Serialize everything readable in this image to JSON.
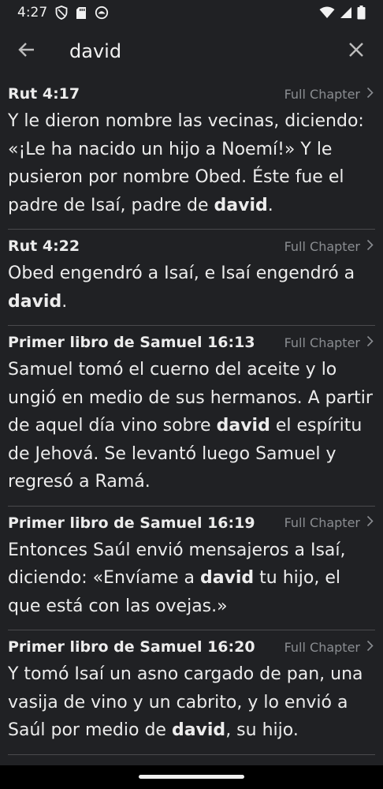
{
  "status_bar": {
    "time": "4:27",
    "icons": [
      "shield-icon",
      "sd-card-icon",
      "app-notification-icon",
      "wifi-icon",
      "signal-icon",
      "battery-icon"
    ]
  },
  "search": {
    "query": "david",
    "icons": {
      "back": "arrow-left-icon",
      "clear": "close-icon"
    }
  },
  "full_chapter_label": "Full Chapter",
  "results": [
    {
      "reference": "Rut 4:17",
      "verse": [
        {
          "t": "Y le dieron nombre las vecinas, diciendo: «¡Le ha nacido un hijo a Noemí!» Y le pusieron por nombre Obed. Éste fue el padre de Isaí, padre de ",
          "b": false
        },
        {
          "t": "david",
          "b": true
        },
        {
          "t": ".",
          "b": false
        }
      ]
    },
    {
      "reference": "Rut 4:22",
      "verse": [
        {
          "t": "Obed engendró a Isaí, e Isaí engendró a ",
          "b": false
        },
        {
          "t": "david",
          "b": true
        },
        {
          "t": ".",
          "b": false
        }
      ]
    },
    {
      "reference": "Primer libro de Samuel 16:13",
      "verse": [
        {
          "t": "Samuel tomó el cuerno del aceite y lo ungió en medio de sus hermanos. A partir de aquel día vino sobre ",
          "b": false
        },
        {
          "t": "david",
          "b": true
        },
        {
          "t": " el espíritu de Jehová. Se levantó luego Samuel y regresó a Ramá.",
          "b": false
        }
      ]
    },
    {
      "reference": "Primer libro de Samuel 16:19",
      "verse": [
        {
          "t": "Entonces Saúl envió mensajeros a Isaí, diciendo: «Envíame a ",
          "b": false
        },
        {
          "t": "david",
          "b": true
        },
        {
          "t": " tu hijo, el que está con las ovejas.»",
          "b": false
        }
      ]
    },
    {
      "reference": "Primer libro de Samuel 16:20",
      "verse": [
        {
          "t": "Y tomó Isaí un asno cargado de pan, una vasija de vino y un cabrito, y lo envió a Saúl por medio de ",
          "b": false
        },
        {
          "t": "david",
          "b": true
        },
        {
          "t": ", su hijo.",
          "b": false
        }
      ]
    }
  ],
  "colors": {
    "background": "#202124",
    "text": "#ececec",
    "muted": "#8a8d91",
    "divider": "#4a4a4d"
  }
}
